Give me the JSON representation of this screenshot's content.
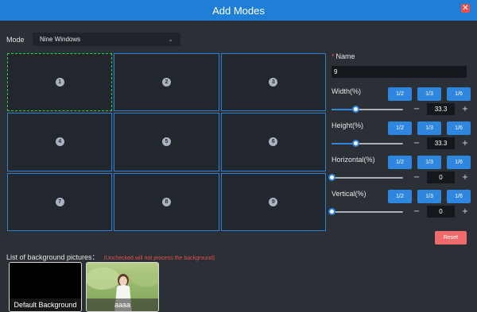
{
  "window": {
    "title": "Add Modes",
    "close_glyph": "✕"
  },
  "mode": {
    "label": "Mode",
    "selected": "Nine Windows"
  },
  "grid": {
    "cells": [
      "1",
      "2",
      "3",
      "4",
      "5",
      "6",
      "7",
      "8",
      "9"
    ],
    "selected_cell": "1"
  },
  "panel": {
    "name": {
      "label": "Name",
      "required_mark": "*",
      "value": "9"
    },
    "width": {
      "label": "Width(%)",
      "value": "33.3",
      "slider_fraction": 0.333
    },
    "height": {
      "label": "Height(%)",
      "value": "33.3",
      "slider_fraction": 0.333
    },
    "horizontal": {
      "label": "Horizontal(%)",
      "value": "0",
      "slider_fraction": 0
    },
    "vertical": {
      "label": "Vertical(%)",
      "value": "0",
      "slider_fraction": 0
    },
    "fractions": [
      "1/2",
      "1/3",
      "1/6"
    ],
    "minus": "−",
    "plus": "+",
    "reset_label": "Reset"
  },
  "backgrounds": {
    "title": "List of background pictures：",
    "note": "(Unchecked will not process the background)",
    "items": [
      {
        "label": "Default Background"
      },
      {
        "label": "aaaa"
      }
    ]
  },
  "colors": {
    "accent": "#2e86de",
    "titlebar": "#1f7fd6",
    "danger": "#f06b6b",
    "selected_border": "#28d24c"
  }
}
